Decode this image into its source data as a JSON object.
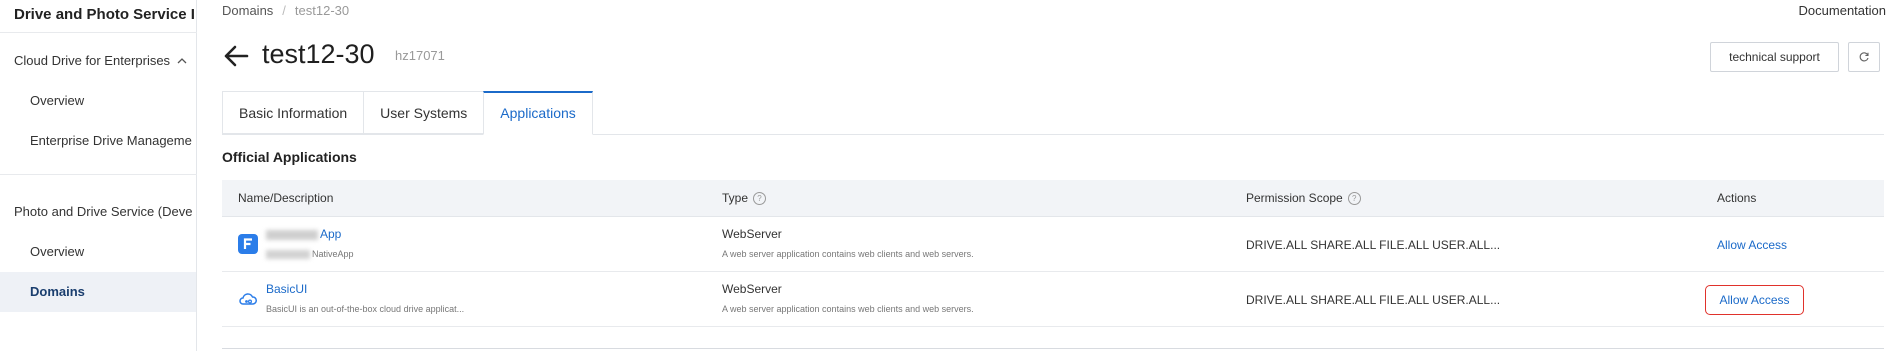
{
  "sidebar": {
    "title": "Drive and Photo Service I",
    "group1": {
      "label": "Cloud Drive for Enterprises",
      "chevron": "chevron-up-icon"
    },
    "group1_items": [
      {
        "label": "Overview"
      },
      {
        "label": "Enterprise Drive Manageme"
      }
    ],
    "group2": {
      "label": "Photo and Drive Service (Deve"
    },
    "group2_items": [
      {
        "label": "Overview",
        "active": false
      },
      {
        "label": "Domains",
        "active": true
      }
    ]
  },
  "breadcrumb": {
    "parent": "Domains",
    "separator": "/",
    "current": "test12-30"
  },
  "header": {
    "documentation": "Documentation",
    "back_icon": "arrow-left-icon",
    "title": "test12-30",
    "subtitle": "hz17071",
    "support_button": "technical support",
    "refresh_icon": "refresh-icon"
  },
  "tabs": [
    {
      "label": "Basic Information",
      "active": false
    },
    {
      "label": "User Systems",
      "active": false
    },
    {
      "label": "Applications",
      "active": true
    }
  ],
  "section_title": "Official Applications",
  "table": {
    "columns": {
      "name": "Name/Description",
      "type": "Type",
      "permission": "Permission Scope",
      "actions": "Actions"
    },
    "rows": [
      {
        "name": "App",
        "description": "NativeApp",
        "icon": "f-app-icon",
        "type": "WebServer",
        "type_desc": "A web server application contains web clients and web servers.",
        "permission": "DRIVE.ALL SHARE.ALL FILE.ALL USER.ALL...",
        "action": "Allow Access",
        "highlighted": false
      },
      {
        "name": "BasicUI",
        "description": "BasicUI is an out-of-the-box cloud drive applicat...",
        "icon": "cloud-app-icon",
        "type": "WebServer",
        "type_desc": "A web server application contains web clients and web servers.",
        "permission": "DRIVE.ALL SHARE.ALL FILE.ALL USER.ALL...",
        "action": "Allow Access",
        "highlighted": true
      }
    ]
  },
  "colors": {
    "accent": "#1b6ac9",
    "highlight_border": "#e0322b",
    "active_sidebar_bg": "#eef1f6",
    "table_header_bg": "#f2f4f7"
  }
}
